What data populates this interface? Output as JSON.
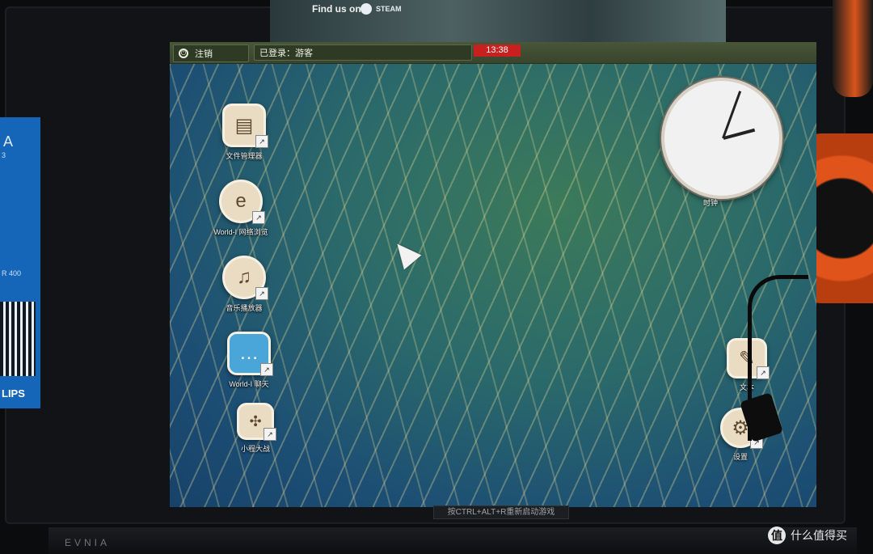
{
  "topbar": {
    "logout_label": "注销",
    "user_status": "已登录：游客",
    "time": "13:38"
  },
  "desktop_icons_left": [
    {
      "label": "文件管理器",
      "icon": "folder-icon"
    },
    {
      "label": "World-I 网络浏览",
      "icon": "browser-icon"
    },
    {
      "label": "音乐播放器",
      "icon": "music-disc-icon"
    },
    {
      "label": "World-I 聊天",
      "icon": "chat-bubble-icon"
    },
    {
      "label": "小程大战",
      "icon": "puzzle-game-icon"
    }
  ],
  "desktop_icons_right": [
    {
      "label": "文本",
      "icon": "text-editor-icon"
    },
    {
      "label": "设置",
      "icon": "gear-icon"
    }
  ],
  "clock_widget": {
    "label": "时钟"
  },
  "bottom_hint": "按CTRL+ALT+R重新启动游戏",
  "steam_banner": {
    "text": "Find us on",
    "brand": "STEAM"
  },
  "monitor_brand": "EVNIA",
  "poster": {
    "letter": "A",
    "small": "3",
    "model": "R 400",
    "logo": "LIPS"
  },
  "watermark": {
    "icon": "值",
    "text": "什么值得买"
  }
}
